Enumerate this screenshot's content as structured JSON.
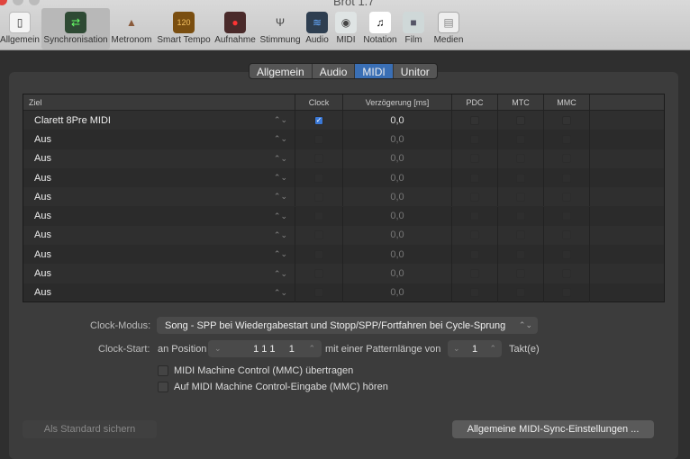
{
  "window": {
    "title": "Brot 1.7"
  },
  "toolbar": [
    {
      "label": "Allgemein",
      "icon": "switch-icon"
    },
    {
      "label": "Synchronisation",
      "icon": "sync-arrows-icon",
      "selected": true
    },
    {
      "label": "Metronom",
      "icon": "metronome-icon"
    },
    {
      "label": "Smart Tempo",
      "icon": "smart-tempo-icon",
      "badge": "120"
    },
    {
      "label": "Aufnahme",
      "icon": "record-icon"
    },
    {
      "label": "Stimmung",
      "icon": "tuning-fork-icon"
    },
    {
      "label": "Audio",
      "icon": "waveform-icon"
    },
    {
      "label": "MIDI",
      "icon": "midi-plug-icon"
    },
    {
      "label": "Notation",
      "icon": "note-icon"
    },
    {
      "label": "Film",
      "icon": "camera-icon"
    },
    {
      "label": "Medien",
      "icon": "media-icon"
    }
  ],
  "tabs": [
    {
      "label": "Allgemein"
    },
    {
      "label": "Audio"
    },
    {
      "label": "MIDI",
      "selected": true
    },
    {
      "label": "Unitor"
    }
  ],
  "table": {
    "headers": [
      "Ziel",
      "Clock",
      "Verzögerung [ms]",
      "PDC",
      "MTC",
      "MMC"
    ],
    "rows": [
      {
        "ziel": "Clarett 8Pre MIDI",
        "clock": true,
        "delay": "0,0",
        "active": true
      },
      {
        "ziel": "Aus",
        "clock": false,
        "delay": "0,0"
      },
      {
        "ziel": "Aus",
        "clock": false,
        "delay": "0,0"
      },
      {
        "ziel": "Aus",
        "clock": false,
        "delay": "0,0"
      },
      {
        "ziel": "Aus",
        "clock": false,
        "delay": "0,0"
      },
      {
        "ziel": "Aus",
        "clock": false,
        "delay": "0,0"
      },
      {
        "ziel": "Aus",
        "clock": false,
        "delay": "0,0"
      },
      {
        "ziel": "Aus",
        "clock": false,
        "delay": "0,0"
      },
      {
        "ziel": "Aus",
        "clock": false,
        "delay": "0,0"
      },
      {
        "ziel": "Aus",
        "clock": false,
        "delay": "0,0"
      }
    ]
  },
  "clock_mode": {
    "label": "Clock-Modus:",
    "value": "Song - SPP bei Wiedergabestart und Stopp/SPP/Fortfahren bei Cycle-Sprung"
  },
  "clock_start": {
    "label": "Clock-Start:",
    "prefix": "an Position",
    "position": "1 1 1     1",
    "middle": "mit einer Patternlänge von",
    "pattern": "1",
    "suffix": "Takt(e)"
  },
  "options": [
    {
      "label": "MIDI Machine Control (MMC) übertragen",
      "checked": false
    },
    {
      "label": "Auf MIDI Machine Control-Eingabe (MMC) hören",
      "checked": false
    }
  ],
  "buttons": {
    "save_default": "Als Standard sichern",
    "general_sync": "Allgemeine MIDI-Sync-Einstellungen ..."
  }
}
